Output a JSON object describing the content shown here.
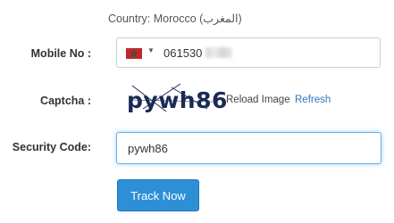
{
  "country": {
    "text": "Country: Morocco (المغرب)"
  },
  "mobile": {
    "label": "Mobile No :",
    "flag_icon": "morocco-flag-icon",
    "flag_color": "#c1272d",
    "value": "061530"
  },
  "captcha": {
    "label": "Captcha :",
    "image_text": "pywh86",
    "reload_text": "Reload Image",
    "refresh_label": "Refresh"
  },
  "security": {
    "label": "Security Code:",
    "value": "pywh86"
  },
  "actions": {
    "track_label": "Track Now"
  },
  "colors": {
    "accent": "#2d8fd6",
    "link": "#2a7bbf"
  }
}
